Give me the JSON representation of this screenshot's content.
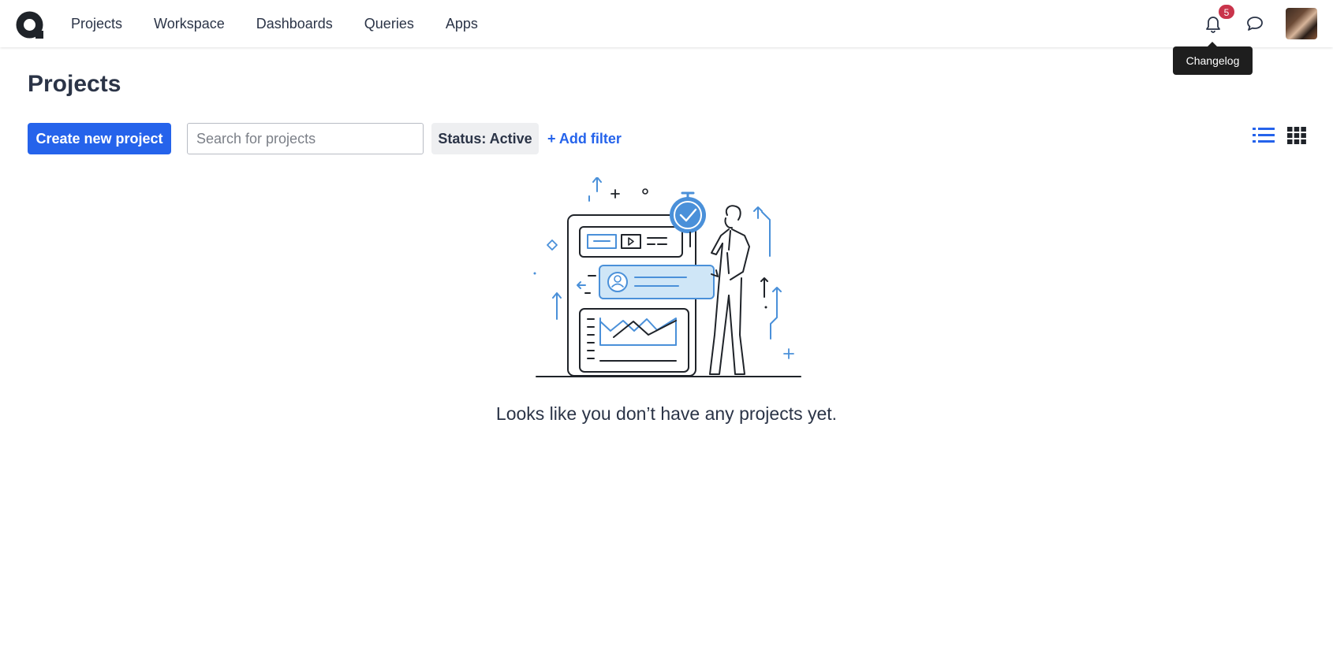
{
  "nav": {
    "items": [
      {
        "label": "Projects"
      },
      {
        "label": "Workspace"
      },
      {
        "label": "Dashboards"
      },
      {
        "label": "Queries"
      },
      {
        "label": "Apps"
      }
    ]
  },
  "header": {
    "notification_count": "5",
    "tooltip": "Changelog"
  },
  "page": {
    "title": "Projects",
    "create_button": "Create new project",
    "search_placeholder": "Search for projects",
    "search_value": "",
    "status_filter": "Status: Active",
    "add_filter": "+ Add filter",
    "empty_message": "Looks like you don’t have any projects yet."
  },
  "colors": {
    "accent": "#2563eb",
    "badge": "#c9344b",
    "text": "#2b3447"
  }
}
